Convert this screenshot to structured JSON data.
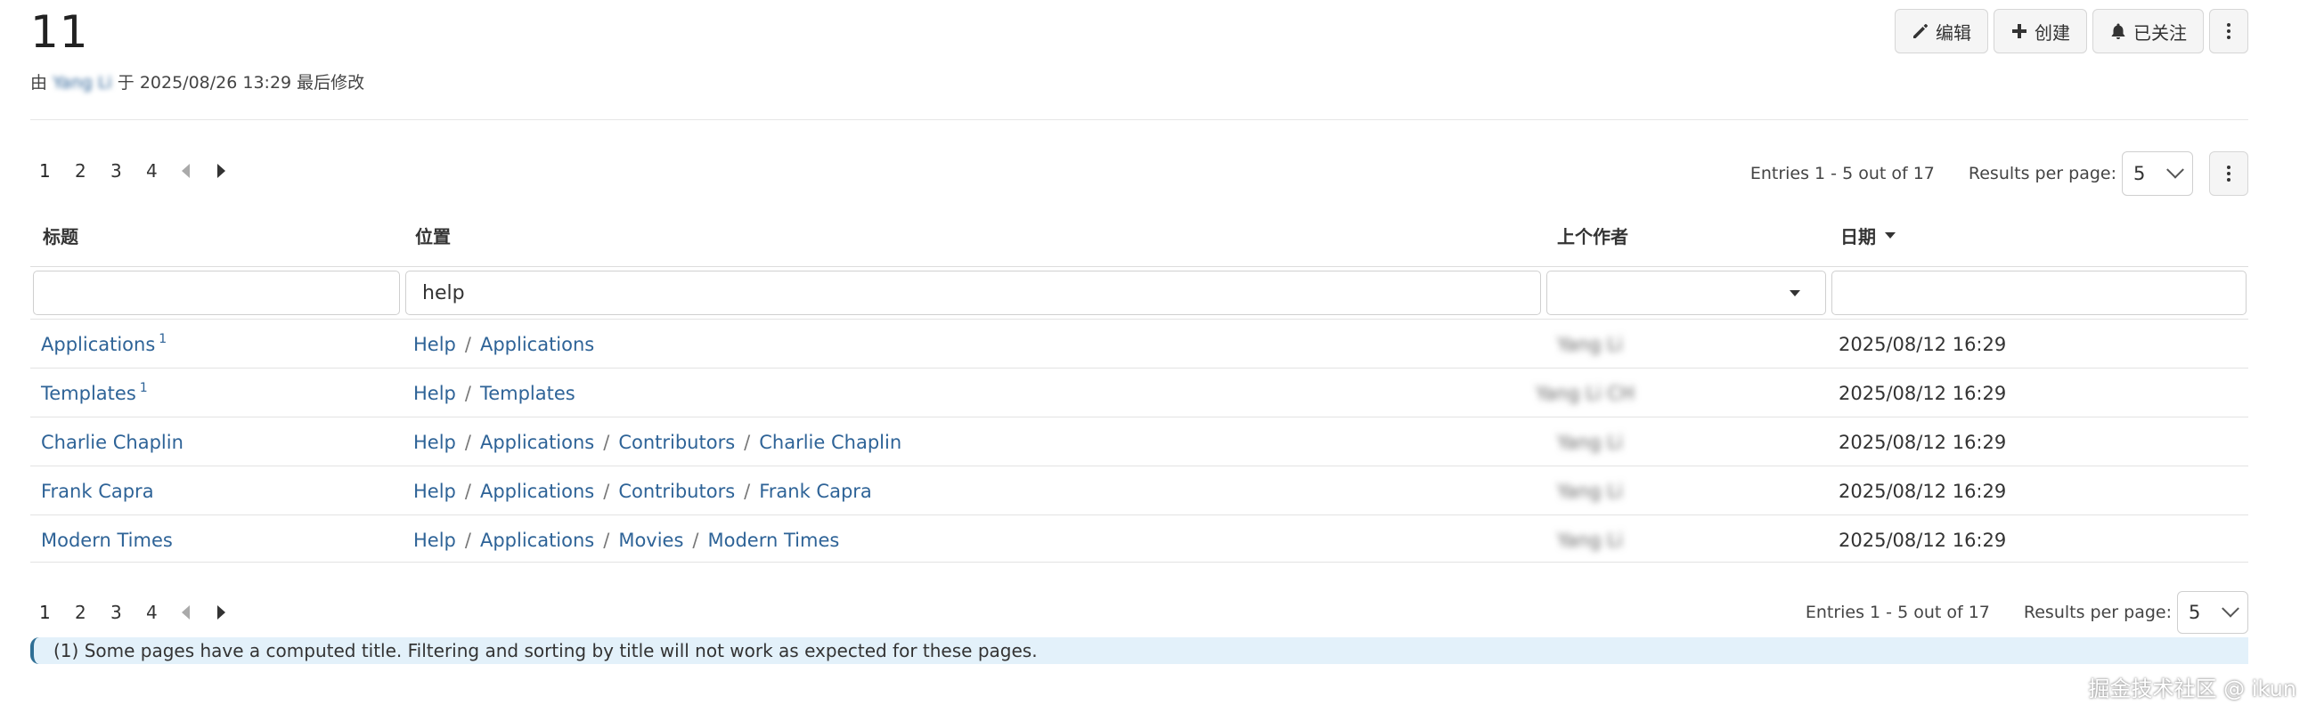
{
  "page": {
    "title": "11",
    "meta_prefix": "由",
    "meta_author": "Yang Li",
    "meta_middle": "于",
    "meta_timestamp": "2025/08/26 13:29",
    "meta_suffix": "最后修改"
  },
  "actions": {
    "edit": "编辑",
    "create": "创建",
    "watching": "已关注"
  },
  "pagination": {
    "pages": [
      "1",
      "2",
      "3",
      "4"
    ],
    "current": "1",
    "entries_text": "Entries 1 - 5 out of 17",
    "results_per_page_label": "Results per page:",
    "results_per_page_value": "5"
  },
  "table": {
    "columns": {
      "title": "标题",
      "location": "位置",
      "author": "上个作者",
      "date": "日期"
    },
    "filters": {
      "title": "",
      "location": "help",
      "author": "",
      "date": ""
    },
    "rows": [
      {
        "title": "Applications",
        "note": "1",
        "path": [
          "Help",
          "Applications"
        ],
        "author": "Yang Li",
        "date": "2025/08/12 16:29"
      },
      {
        "title": "Templates",
        "note": "1",
        "path": [
          "Help",
          "Templates"
        ],
        "author": "Yang Li CH",
        "date": "2025/08/12 16:29"
      },
      {
        "title": "Charlie Chaplin",
        "note": "",
        "path": [
          "Help",
          "Applications",
          "Contributors",
          "Charlie Chaplin"
        ],
        "author": "Yang Li",
        "date": "2025/08/12 16:29"
      },
      {
        "title": "Frank Capra",
        "note": "",
        "path": [
          "Help",
          "Applications",
          "Contributors",
          "Frank Capra"
        ],
        "author": "Yang Li",
        "date": "2025/08/12 16:29"
      },
      {
        "title": "Modern Times",
        "note": "",
        "path": [
          "Help",
          "Applications",
          "Movies",
          "Modern Times"
        ],
        "author": "Yang Li",
        "date": "2025/08/12 16:29"
      }
    ]
  },
  "note": {
    "text": "(1) Some pages have a computed title. Filtering and sorting by title will not work as expected for these pages."
  },
  "watermark": "掘金技术社区 @ ikun",
  "colors": {
    "link": "#2e6397",
    "note_bg": "#e3f1fa",
    "note_border": "#2f6f95"
  }
}
